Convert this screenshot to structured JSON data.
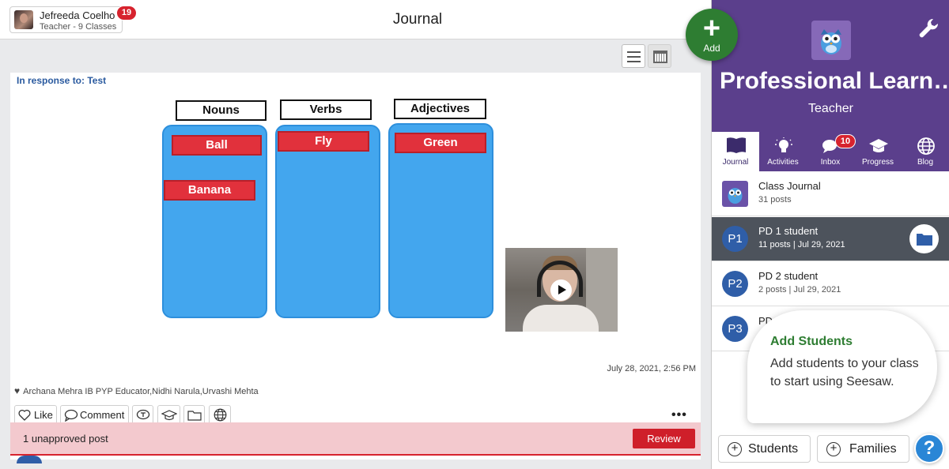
{
  "header": {
    "user_name": "Jefreeda Coelho",
    "user_sub": "Teacher - 9 Classes",
    "notifications": "19",
    "title": "Journal",
    "add_label": "Add"
  },
  "post": {
    "in_response": "In response to: Test",
    "columns": [
      {
        "header": "Nouns",
        "cards": [
          "Ball",
          "Banana"
        ]
      },
      {
        "header": "Verbs",
        "cards": [
          "Fly"
        ]
      },
      {
        "header": "Adjectives",
        "cards": [
          "Green"
        ]
      }
    ],
    "date": "July 28, 2021, 2:56 PM",
    "likes": "Archana Mehra IB PYP Educator,Nidhi Narula,Urvashi Mehta",
    "like_label": "Like",
    "comment_label": "Comment",
    "more": "•••",
    "unapproved_text": "1 unapproved post",
    "review_label": "Review"
  },
  "class_panel": {
    "name": "Professional Learn…",
    "role": "Teacher",
    "tabs": [
      {
        "label": "Journal",
        "icon": "book-icon"
      },
      {
        "label": "Activities",
        "icon": "lightbulb-icon"
      },
      {
        "label": "Inbox",
        "icon": "chat-icon",
        "badge": "10"
      },
      {
        "label": "Progress",
        "icon": "graduation-cap-icon"
      },
      {
        "label": "Blog",
        "icon": "globe-icon"
      }
    ],
    "items": [
      {
        "avatar": "",
        "title": "Class Journal",
        "sub": "31 posts"
      },
      {
        "avatar": "P1",
        "title": "PD 1 student",
        "sub": "11 posts | Jul 29, 2021"
      },
      {
        "avatar": "P2",
        "title": "PD 2 student",
        "sub": "2 posts | Jul 29, 2021"
      },
      {
        "avatar": "P3",
        "title": "PD",
        "sub": ""
      }
    ],
    "tooltip_title": "Add Students",
    "tooltip_body": "Add students to your class to start using Seesaw.",
    "students_label": "Students",
    "families_label": "Families",
    "help": "?"
  },
  "colors": {
    "purple": "#5b3f8c",
    "add_green": "#2e7d32",
    "review_red": "#cf1f2a",
    "link_blue": "#2a5a9f"
  }
}
